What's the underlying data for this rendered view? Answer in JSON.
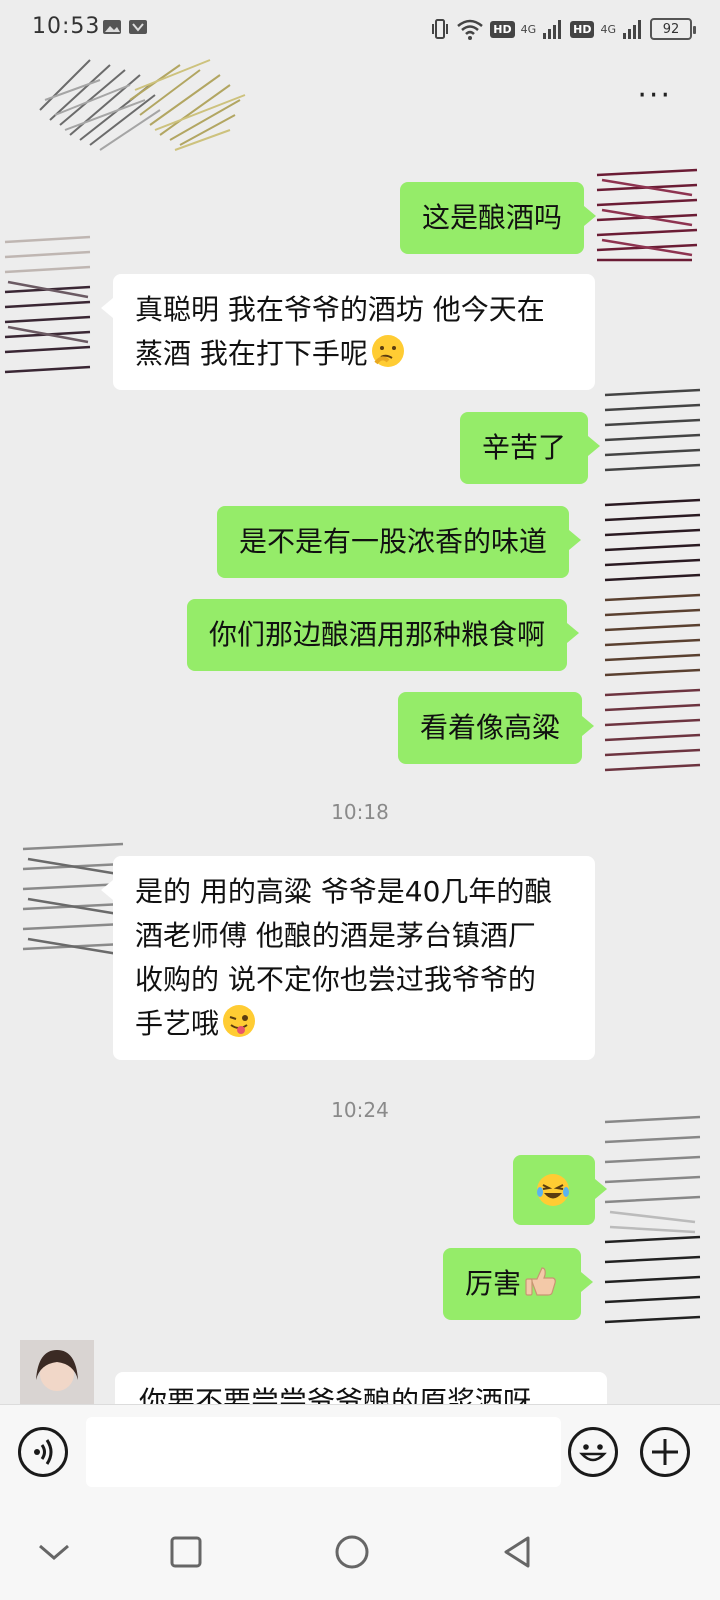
{
  "status_bar": {
    "time": "10:53",
    "hd1": "HD",
    "net1": "4G",
    "hd2": "HD",
    "net2": "4G",
    "battery": "92"
  },
  "header": {
    "more": "···"
  },
  "messages": [
    {
      "side": "me",
      "text": "这是酿酒吗"
    },
    {
      "side": "them",
      "line1": "真聪明 我在爷爷的酒坊 他今天在",
      "line2": "蒸酒 我在打下手呢",
      "emoji": "thinking-face"
    },
    {
      "side": "me",
      "text": "辛苦了"
    },
    {
      "side": "me",
      "text": "是不是有一股浓香的味道"
    },
    {
      "side": "me",
      "text": "你们那边酿酒用那种粮食啊"
    },
    {
      "side": "me",
      "text": "看着像高粱"
    },
    {
      "side": "them",
      "line1": "是的 用的高粱 爷爷是40几年的酿",
      "line2": "酒老师傅 他酿的酒是茅台镇酒厂",
      "line3": "收购的 说不定你也尝过我爷爷的",
      "line4": "手艺哦",
      "emoji": "winking-tongue-face"
    },
    {
      "side": "me",
      "emoji": "laughing-tears-face"
    },
    {
      "side": "me",
      "text": "厉害",
      "emoji": "thumbs-up"
    },
    {
      "side": "them",
      "text": "你要不要尝尝爷爷酿的原浆酒呀"
    }
  ],
  "timestamps": [
    "10:18",
    "10:24"
  ],
  "input": {
    "placeholder": ""
  },
  "colors": {
    "me_bubble": "#95ec69",
    "them_bubble": "#ffffff",
    "background": "#ededed"
  }
}
